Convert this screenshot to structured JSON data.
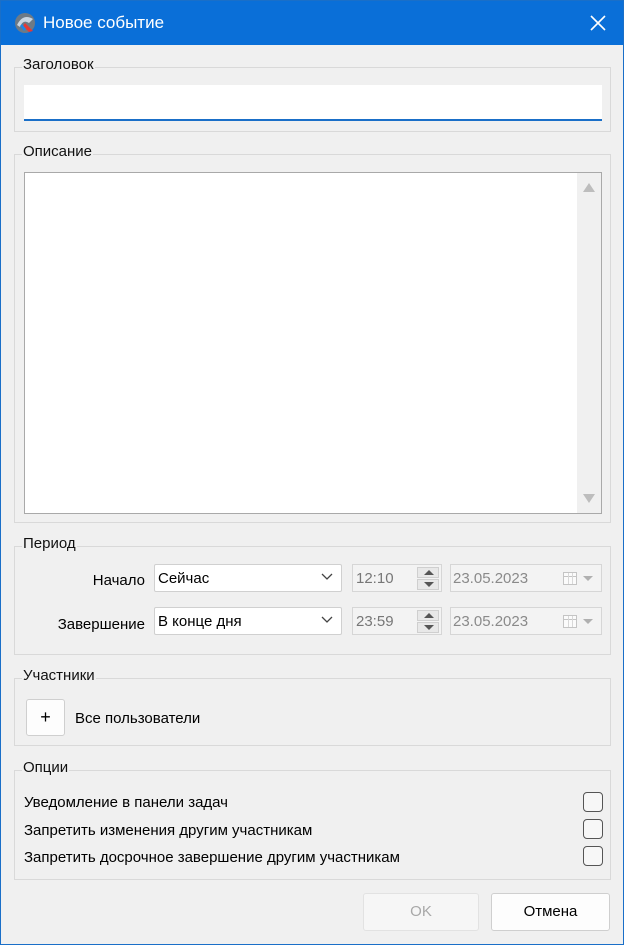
{
  "window": {
    "title": "Новое событие",
    "app_icon": "app-logo-icon",
    "close_icon": "close-icon",
    "accent_color": "#0a6fd8"
  },
  "title_group": {
    "label": "Заголовок",
    "input_value": ""
  },
  "description_group": {
    "label": "Описание",
    "value": ""
  },
  "period_group": {
    "label": "Период",
    "start": {
      "label": "Начало",
      "mode": "Сейчас",
      "time": "12:10",
      "date": "23.05.2023"
    },
    "end": {
      "label": "Завершение",
      "mode": "В конце дня",
      "time": "23:59",
      "date": "23.05.2023"
    }
  },
  "participants_group": {
    "label": "Участники",
    "add_button": "+",
    "participants_text": "Все пользователи"
  },
  "options_group": {
    "label": "Опции",
    "options": [
      {
        "label": "Уведомление в панели задач",
        "checked": false
      },
      {
        "label": "Запретить изменения другим участникам",
        "checked": false
      },
      {
        "label": "Запретить досрочное завершение другим участникам",
        "checked": false
      }
    ]
  },
  "buttons": {
    "ok": "OK",
    "cancel": "Отмена"
  }
}
